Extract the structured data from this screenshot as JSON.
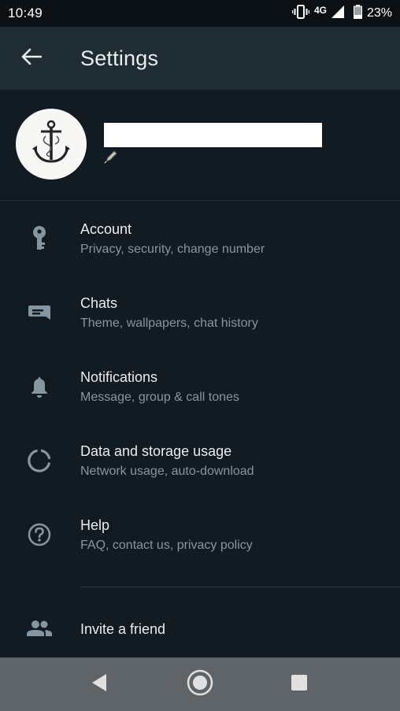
{
  "status_bar": {
    "time": "10:49",
    "network": "4G",
    "battery": "23%"
  },
  "app_bar": {
    "title": "Settings",
    "back_icon": "arrow-left-icon"
  },
  "profile": {
    "name": "",
    "status_icon": "pencil-icon",
    "avatar_icon": "anchor-icon"
  },
  "settings": [
    {
      "icon": "key-icon",
      "title": "Account",
      "subtitle": "Privacy, security, change number"
    },
    {
      "icon": "chat-icon",
      "title": "Chats",
      "subtitle": "Theme, wallpapers, chat history"
    },
    {
      "icon": "bell-icon",
      "title": "Notifications",
      "subtitle": "Message, group & call tones"
    },
    {
      "icon": "data-usage-icon",
      "title": "Data and storage usage",
      "subtitle": "Network usage, auto-download"
    },
    {
      "icon": "help-icon",
      "title": "Help",
      "subtitle": "FAQ, contact us, privacy policy"
    }
  ],
  "invite": {
    "icon": "people-icon",
    "label": "Invite a friend"
  },
  "nav_bar": {
    "back": "nav-back-icon",
    "home": "nav-home-icon",
    "recents": "nav-recents-icon"
  },
  "colors": {
    "background": "#121b22",
    "app_bar": "#202c33",
    "text_primary": "#e9edef",
    "text_secondary": "#8696a0",
    "icon": "#8696a0"
  }
}
